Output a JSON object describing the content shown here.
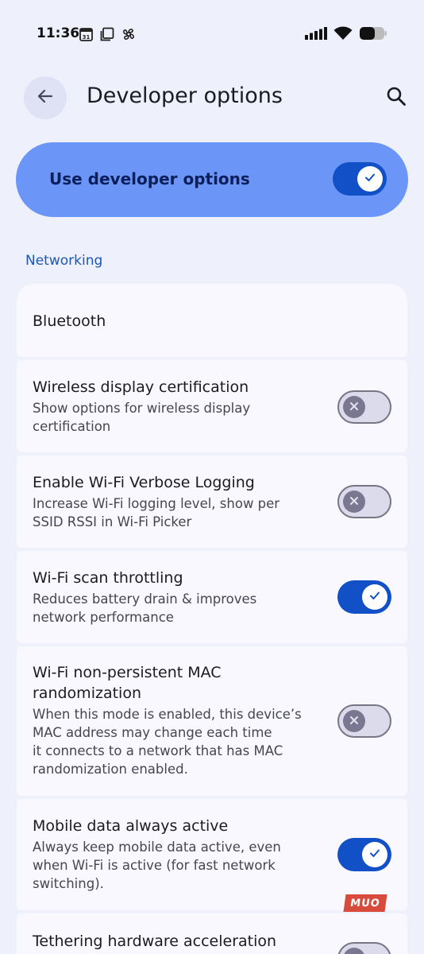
{
  "status_bar": {
    "time": "11:36",
    "calendar_day": "31",
    "left_icons": [
      "calendar-icon",
      "screenshot-icon",
      "pinwheel-icon"
    ],
    "right_icons": [
      "signal-icon",
      "wifi-icon",
      "battery-icon"
    ]
  },
  "app_bar": {
    "title": "Developer options",
    "back_icon": "arrow-back-icon",
    "search_icon": "search-icon"
  },
  "master_toggle": {
    "label": "Use developer options",
    "enabled": true
  },
  "section": {
    "title": "Networking"
  },
  "settings": [
    {
      "title": "Bluetooth",
      "summary": "",
      "toggle": null
    },
    {
      "title": "Wireless display certification",
      "summary_lines": [
        "Show options for wireless display",
        "certification"
      ],
      "toggle": false
    },
    {
      "title": "Enable Wi-Fi Verbose Logging",
      "summary_lines": [
        "Increase Wi-Fi logging level, show per",
        "SSID RSSI in Wi-Fi Picker"
      ],
      "toggle": false
    },
    {
      "title": "Wi-Fi scan throttling",
      "summary_lines": [
        "Reduces battery drain & improves",
        "network performance"
      ],
      "toggle": true
    },
    {
      "title_lines": [
        "Wi-Fi non-persistent MAC",
        "randomization"
      ],
      "summary_lines": [
        "When this mode is enabled, this device’s",
        "MAC address may change each time",
        "it connects to a network that has MAC",
        "randomization enabled."
      ],
      "toggle": false
    },
    {
      "title": "Mobile data always active",
      "summary_lines": [
        "Always keep mobile data active, even",
        "when Wi-Fi is active (for fast network",
        "switching)."
      ],
      "toggle": true
    },
    {
      "title": "Tethering hardware acceleration",
      "toggle": false
    }
  ],
  "watermark": "MUO",
  "colors": {
    "background": "#eef0fb",
    "master_card": "#6b95f6",
    "switch_on": "#1250c8",
    "switch_off": "#dcdbec",
    "accent_text": "#1d56b8"
  }
}
